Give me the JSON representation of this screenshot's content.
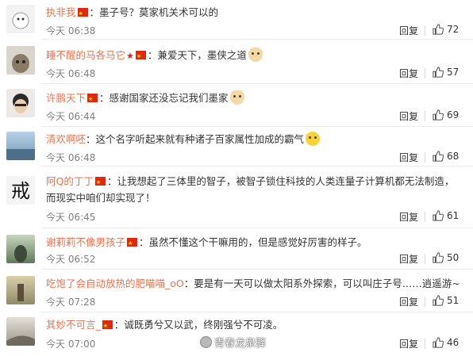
{
  "comments": [
    {
      "user": "执非我",
      "text": "：墨子号？莫家机关术可以的",
      "time": "今天 06:38",
      "reply": "回复",
      "likes": "72",
      "emoji": "",
      "extra_badge": false
    },
    {
      "user": "睡不醒的马各马它",
      "text": "：兼爱天下，墨侠之道",
      "time": "今天 06:48",
      "reply": "回复",
      "likes": "57",
      "emoji": "dog",
      "extra_badge": true
    },
    {
      "user": "许鹏天下",
      "text": "：感谢国家还没忘记我们墨家",
      "time": "今天 06:44",
      "reply": "回复",
      "likes": "69",
      "emoji": "dog",
      "extra_badge": false
    },
    {
      "user": "清欢啊呸",
      "text": "：这个名字听起来就有种诸子百家属性加成的霸气",
      "time": "今天 06:48",
      "reply": "回复",
      "likes": "68",
      "emoji": "laugh",
      "extra_badge": false
    },
    {
      "user": "阿Q的丁丁",
      "text": "：让我想起了三体里的智子，被智子锁住科技的人类连量子计算机都无法制造，而现实中咱们却实现了！",
      "time": "今天 06:45",
      "reply": "回复",
      "likes": "61",
      "emoji": "",
      "extra_badge": false
    },
    {
      "user": "谢莉莉不像男孩子",
      "text": "：虽然不懂这个干嘛用的，但是感觉好厉害的样子。",
      "time": "今天 06:52",
      "reply": "回复",
      "likes": "50",
      "emoji": "",
      "extra_badge": false
    },
    {
      "user": "吃饱了会自动放热的肥喵喵_oO",
      "text": "：要是有一天可以做太阳系外探索，可以叫庄子号……逍遥游~",
      "time": "今天 07:28",
      "reply": "回复",
      "likes": "51",
      "emoji": "",
      "extra_badge": false
    },
    {
      "user": "其妙不可言_",
      "text": "：诚既勇兮又以武，终刚强兮不可凌。",
      "time": "今天 07:00",
      "reply": "回复",
      "likes": "46",
      "emoji": "",
      "extra_badge": false
    }
  ],
  "watermark": "青春龙泉驿",
  "colors": {
    "username": "#eb7350",
    "time": "#808080",
    "flag": "#de2910"
  },
  "icons": {
    "like": "thumbs-up-icon",
    "flag": "china-flag-icon"
  }
}
